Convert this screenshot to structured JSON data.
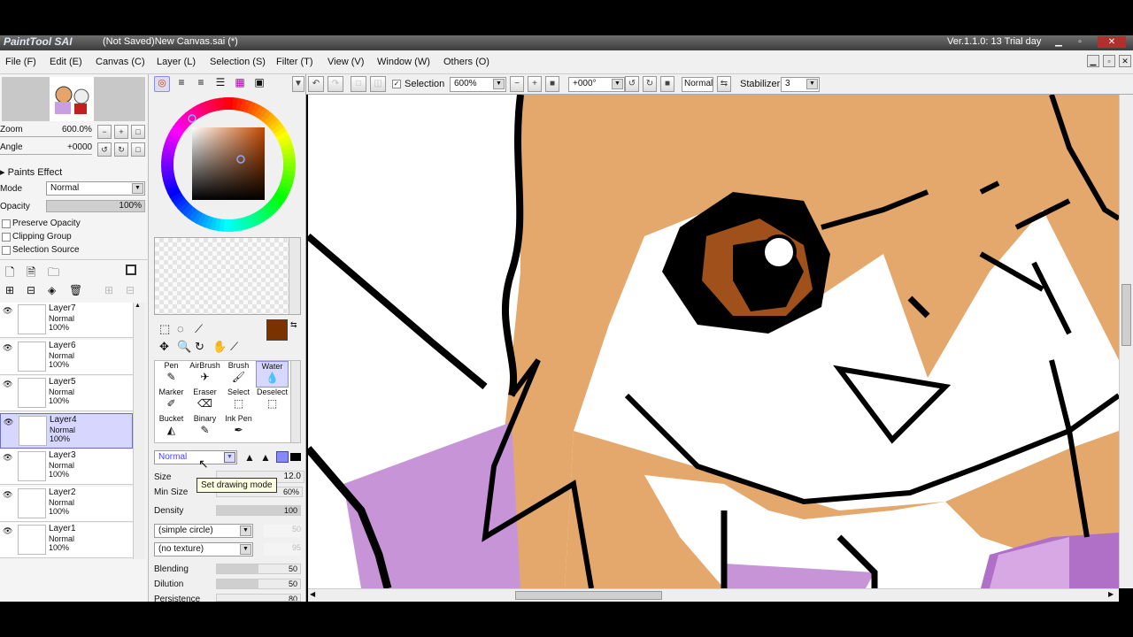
{
  "window": {
    "logo": "PaintTool SAI",
    "title": "(Not Saved)New Canvas.sai (*)",
    "version": "Ver.1.1.0: 13 Trial day"
  },
  "menu": [
    "File (F)",
    "Edit (E)",
    "Canvas (C)",
    "Layer (L)",
    "Selection (S)",
    "Filter (T)",
    "View (V)",
    "Window (W)",
    "Others (O)"
  ],
  "navigator": {
    "zoom_label": "Zoom",
    "zoom_value": "600.0%",
    "angle_label": "Angle",
    "angle_value": "+0000"
  },
  "layer_props": {
    "paints_effect": "Paints Effect",
    "mode_label": "Mode",
    "mode_value": "Normal",
    "opacity_label": "Opacity",
    "opacity_value": "100%",
    "preserve_opacity": "Preserve Opacity",
    "clipping_group": "Clipping Group",
    "selection_source": "Selection Source"
  },
  "layers": [
    {
      "name": "Layer7",
      "mode": "Normal",
      "opacity": "100%",
      "selected": false
    },
    {
      "name": "Layer6",
      "mode": "Normal",
      "opacity": "100%",
      "selected": false
    },
    {
      "name": "Layer5",
      "mode": "Normal",
      "opacity": "100%",
      "selected": false
    },
    {
      "name": "Layer4",
      "mode": "Normal",
      "opacity": "100%",
      "selected": true
    },
    {
      "name": "Layer3",
      "mode": "Normal",
      "opacity": "100%",
      "selected": false
    },
    {
      "name": "Layer2",
      "mode": "Normal",
      "opacity": "100%",
      "selected": false
    },
    {
      "name": "Layer1",
      "mode": "Normal",
      "opacity": "100%",
      "selected": false
    }
  ],
  "colors": {
    "primary": "#7a3300",
    "secondary": "#ffffff",
    "accent": "#3a6ad0"
  },
  "tools": [
    {
      "label": "Pen",
      "icon": "pen-icon",
      "selected": false
    },
    {
      "label": "AirBrush",
      "icon": "airbrush-icon",
      "selected": false
    },
    {
      "label": "Brush",
      "icon": "brush-icon",
      "selected": false
    },
    {
      "label": "Water",
      "icon": "water-icon",
      "selected": true
    },
    {
      "label": "Marker",
      "icon": "marker-icon",
      "selected": false
    },
    {
      "label": "Eraser",
      "icon": "eraser-icon",
      "selected": false
    },
    {
      "label": "Select",
      "icon": "select-icon",
      "selected": false
    },
    {
      "label": "Deselect",
      "icon": "deselect-icon",
      "selected": false
    },
    {
      "label": "Bucket",
      "icon": "bucket-icon",
      "selected": false
    },
    {
      "label": "Binary",
      "icon": "binary-icon",
      "selected": false
    },
    {
      "label": "Ink Pen",
      "icon": "ink-pen-icon",
      "selected": false
    }
  ],
  "tool_settings": {
    "blend_mode": "Normal",
    "tooltip": "Set drawing mode",
    "size_label": "Size",
    "size_value": "12.0",
    "min_size_label": "Min Size",
    "min_size_value": "60%",
    "density_label": "Density",
    "density_value": "100",
    "density_fraction": 1.0,
    "shape": "(simple circle)",
    "shape_value": "50",
    "texture": "(no texture)",
    "texture_value": "95",
    "blending_label": "Blending",
    "blending_value": "50",
    "blending_fraction": 0.5,
    "dilution_label": "Dilution",
    "dilution_value": "50",
    "dilution_fraction": 0.5,
    "persistence_label": "Persistence",
    "persistence_value": "80"
  },
  "toolbar": {
    "selection_label": "Selection",
    "zoom": "600%",
    "angle": "+000°",
    "mode": "Normal",
    "stabilizer_label": "Stabilizer",
    "stabilizer_value": "3"
  }
}
